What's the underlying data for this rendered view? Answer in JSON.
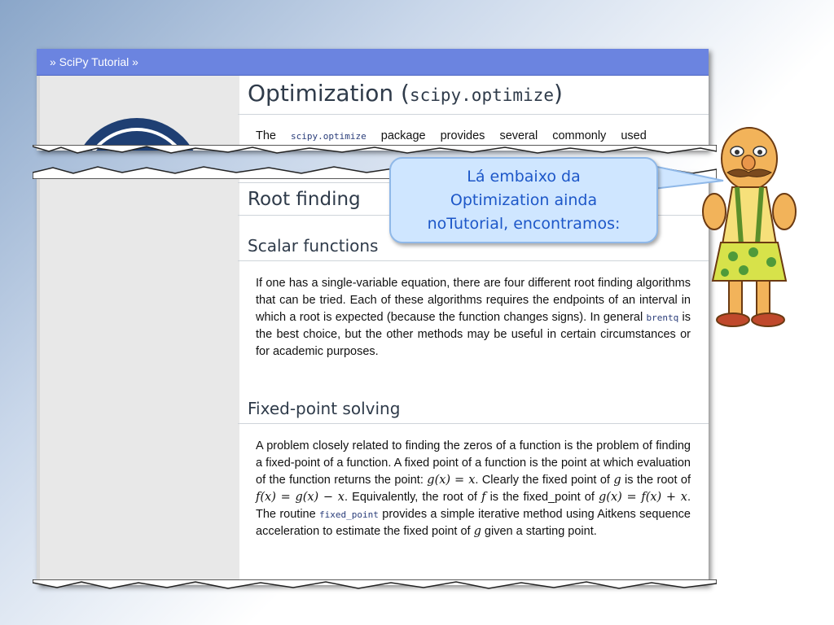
{
  "top_clip": {
    "nav_label": "» SciPy Tutorial »",
    "title_word": "Optimization (",
    "title_code": "scipy.optimize",
    "title_end": ")",
    "intro": {
      "pre": "The ",
      "code": "scipy.optimize",
      "post": " package provides several commonly used"
    }
  },
  "bottom_clip": {
    "root_finding_heading": "Root finding",
    "scalar_heading": "Scalar functions",
    "scalar_text": {
      "pre": "If one has a single-variable equation, there are four different root finding algorithms that can be tried. Each of these algorithms requires the endpoints of an interval in which a root is expected (because the function changes signs). In general ",
      "code": "brentq",
      "post": " is the best choice, but the other methods may be useful in certain circumstances or for academic purposes."
    },
    "fixed_heading": "Fixed-point solving",
    "fixed_text": {
      "p1": "A problem closely related to finding the zeros of a function is the problem of finding a fixed-point of a function. A fixed point of a function is the point at which evaluation of the function returns the point: ",
      "m1": "g(x) = x",
      "p2": ". Clearly the fixed point of ",
      "m2": "g",
      "p3": " is the root of ",
      "m3": "f(x) = g(x) − x",
      "p4": ". Equivalently, the root of ",
      "m4": "f",
      "p5": " is the fixed_point of ",
      "m5": "g(x) = f(x) + x",
      "p6": ". The routine ",
      "code": "fixed_point",
      "p7": " provides a simple iterative method using Aitkens sequence acceleration to estimate the fixed point of ",
      "m6": "g",
      "p8": " given a starting point."
    }
  },
  "speech_bubble": {
    "line1": "Lá embaixo da",
    "line2": "Optimization ainda",
    "line3": "noTutorial, encontramos:"
  },
  "colors": {
    "nav_bar": "#6b84e0",
    "bubble_fill": "#cfe6ff",
    "bubble_text": "#1d57c8"
  },
  "icons": [
    "scipy-logo-icon",
    "cartoon-mascot-icon"
  ]
}
